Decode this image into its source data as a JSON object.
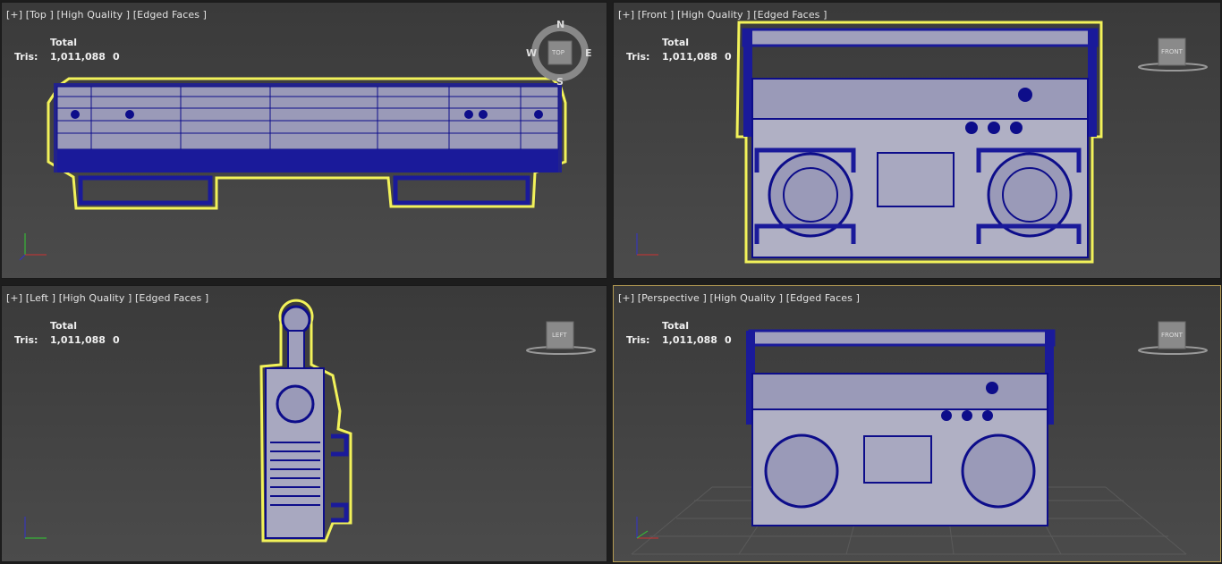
{
  "viewports": [
    {
      "id": "top",
      "label": "[+] [Top ] [High Quality ] [Edged Faces ]",
      "view_cube": "TOP",
      "compass": {
        "n": "N",
        "s": "S",
        "e": "E",
        "w": "W"
      }
    },
    {
      "id": "front",
      "label": "[+] [Front ] [High Quality ] [Edged Faces ]",
      "view_cube": "FRONT"
    },
    {
      "id": "left",
      "label": "[+] [Left ] [High Quality ] [Edged Faces ]",
      "view_cube": "LEFT"
    },
    {
      "id": "perspective",
      "label": "[+] [Perspective ] [High Quality ] [Edged Faces ]",
      "view_cube": "FRONT"
    }
  ],
  "stats": {
    "header": "Total",
    "tris_label": "Tris:",
    "tris_value": "1,011,088",
    "tris_selected": "0"
  },
  "axis": {
    "x": "x",
    "y": "y",
    "z": "z"
  },
  "colors": {
    "wire": "#0d0d8a",
    "selection": "#f2f25a",
    "grid": "#5a5a5a",
    "active_border": "#b39a52"
  }
}
